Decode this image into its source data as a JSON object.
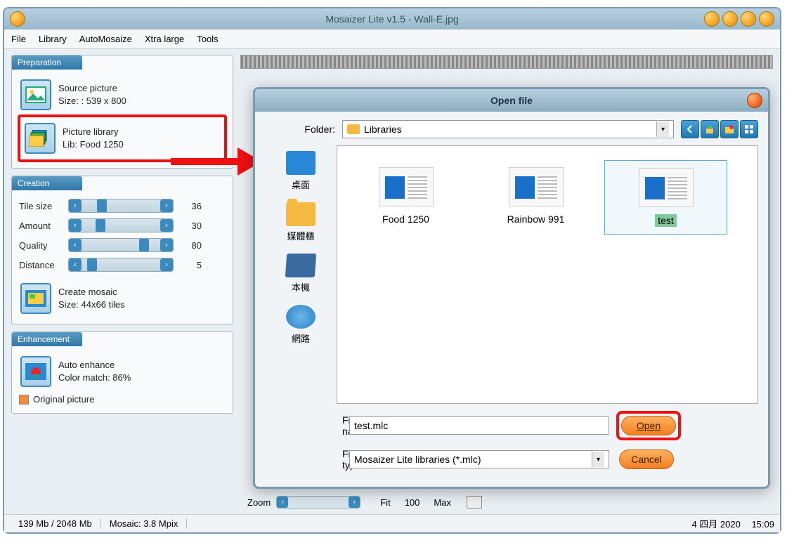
{
  "window": {
    "title": "Mosaizer Lite v1.5 - Wall-E.jpg"
  },
  "menu": {
    "file": "File",
    "library": "Library",
    "automosaize": "AutoMosaize",
    "xtralarge": "Xtra large",
    "tools": "Tools"
  },
  "panels": {
    "preparation": {
      "title": "Preparation",
      "source_picture": "Source picture",
      "source_size": "Size: : 539 x 800",
      "picture_library": "Picture library",
      "lib_name": "Lib: Food 1250"
    },
    "creation": {
      "title": "Creation",
      "tile_size_label": "Tile size",
      "tile_size_value": "36",
      "amount_label": "Amount",
      "amount_value": "30",
      "quality_label": "Quality",
      "quality_value": "80",
      "distance_label": "Distance",
      "distance_value": "5",
      "create_mosaic": "Create mosaic",
      "create_size": "Size:  44x66 tiles"
    },
    "enhancement": {
      "title": "Enhancement",
      "auto_enhance": "Auto enhance",
      "color_match": "Color match:  86%",
      "original_picture": "Original picture"
    }
  },
  "zoom": {
    "label": "Zoom",
    "fit": "Fit",
    "hundred": "100",
    "max": "Max"
  },
  "status": {
    "memory": "139 Mb / 2048 Mb",
    "mosaic": "Mosaic: 3.8 Mpix",
    "date": "4 四月  2020",
    "time": "15:09"
  },
  "dialog": {
    "title": "Open file",
    "folder_label": "Folder:",
    "folder_value": "Libraries",
    "places": {
      "desktop": "桌面",
      "media": "媒體櫃",
      "computer": "本機",
      "network": "網路"
    },
    "files": {
      "food": "Food 1250",
      "rainbow": "Rainbow 991",
      "test": "test"
    },
    "filename_label": "File name:",
    "filename_value": "test.mlc",
    "filetype_label": "File type:",
    "filetype_value": "Mosaizer Lite libraries (*.mlc)",
    "open_btn": "Open",
    "cancel_btn": "Cancel"
  }
}
